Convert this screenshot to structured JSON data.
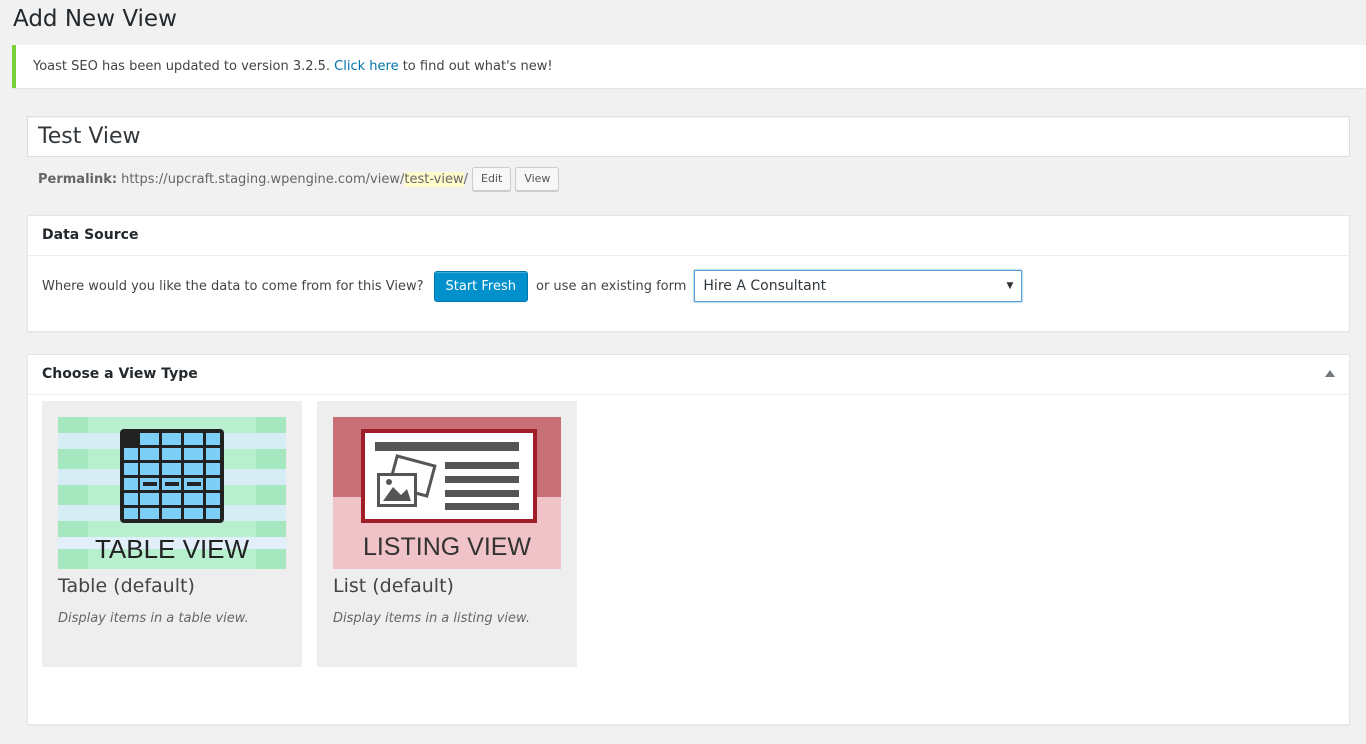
{
  "page": {
    "title": "Add New View"
  },
  "notice": {
    "text_before": "Yoast SEO has been updated to version 3.2.5. ",
    "link_text": "Click here",
    "text_after": " to find out what's new!"
  },
  "post": {
    "title_value": "Test View",
    "permalink_label": "Permalink:",
    "permalink_base": "https://upcraft.staging.wpengine.com/view/",
    "permalink_slug": "test-view",
    "permalink_trailing": "/",
    "edit_label": "Edit",
    "view_label": "View"
  },
  "data_source": {
    "heading": "Data Source",
    "question": "Where would you like the data to come from for this View?",
    "start_fresh_label": "Start Fresh",
    "or_text": "or use an existing form",
    "selected_form": "Hire A Consultant"
  },
  "view_type": {
    "heading": "Choose a View Type",
    "cards": [
      {
        "thumb_text": "TABLE VIEW",
        "name": "Table (default)",
        "description": "Display items in a table view."
      },
      {
        "thumb_text": "LISTING VIEW",
        "name": "List (default)",
        "description": "Display items in a listing view."
      }
    ]
  },
  "colors": {
    "accent": "#0091cd",
    "notice_border": "#7ad03a",
    "link": "#0073aa"
  }
}
